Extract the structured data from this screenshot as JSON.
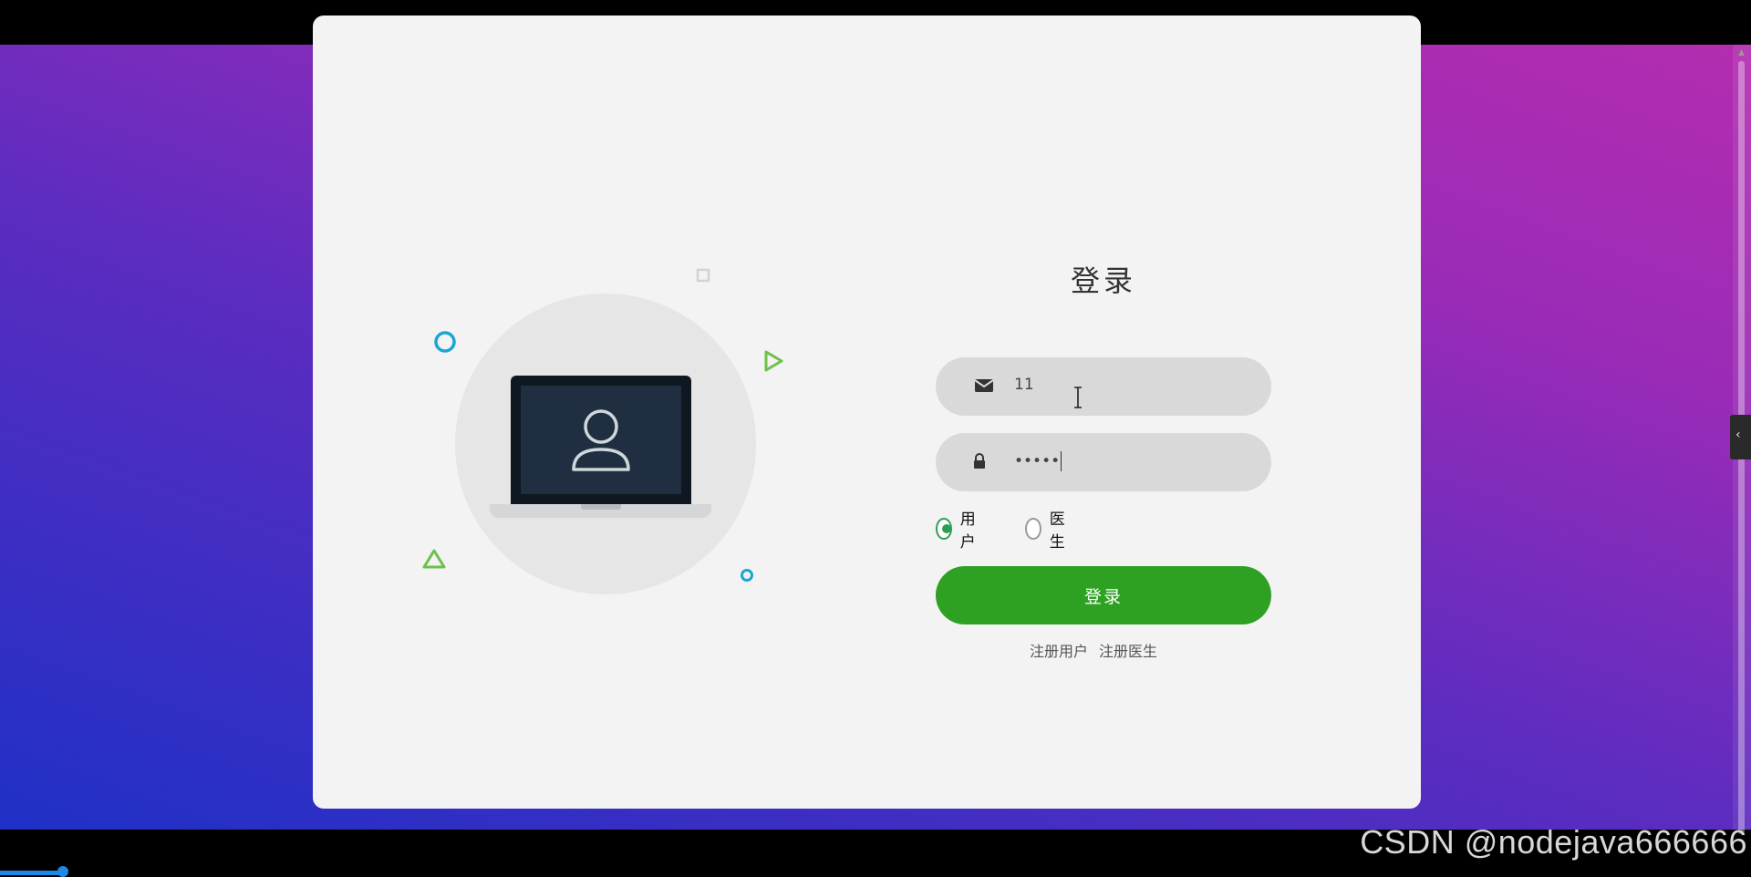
{
  "login": {
    "title": "登录",
    "username_value": "11",
    "password_value": "•••••",
    "roles": [
      "用户",
      "医生"
    ],
    "selected_role": "用户",
    "submit_label": "登录",
    "links": [
      "注册用户",
      "注册医生"
    ]
  },
  "icons": {
    "username": "envelope-icon",
    "password": "lock-icon",
    "avatar": "user-icon",
    "side_toggle": "chevron-left-icon"
  },
  "colors": {
    "accent_green": "#2ea123",
    "radio_green": "#2f9e55",
    "card_bg": "#f3f3f3",
    "field_bg": "#d9d9d9"
  },
  "video": {
    "progress": 0.036
  },
  "watermark": "CSDN @nodejava666666"
}
